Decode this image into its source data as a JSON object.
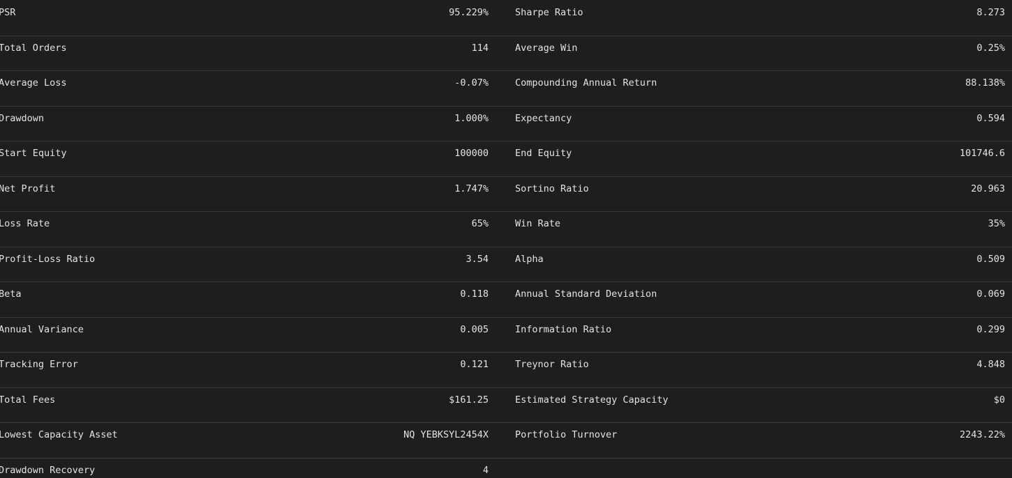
{
  "rows": [
    {
      "left": {
        "label": "PSR",
        "value": "95.229%"
      },
      "right": {
        "label": "Sharpe Ratio",
        "value": "8.273"
      }
    },
    {
      "left": {
        "label": "Total Orders",
        "value": "114"
      },
      "right": {
        "label": "Average Win",
        "value": "0.25%"
      }
    },
    {
      "left": {
        "label": "Average Loss",
        "value": "-0.07%"
      },
      "right": {
        "label": "Compounding Annual Return",
        "value": "88.138%"
      }
    },
    {
      "left": {
        "label": "Drawdown",
        "value": "1.000%"
      },
      "right": {
        "label": "Expectancy",
        "value": "0.594"
      }
    },
    {
      "left": {
        "label": "Start Equity",
        "value": "100000"
      },
      "right": {
        "label": "End Equity",
        "value": "101746.6"
      }
    },
    {
      "left": {
        "label": "Net Profit",
        "value": "1.747%"
      },
      "right": {
        "label": "Sortino Ratio",
        "value": "20.963"
      }
    },
    {
      "left": {
        "label": "Loss Rate",
        "value": "65%"
      },
      "right": {
        "label": "Win Rate",
        "value": "35%"
      }
    },
    {
      "left": {
        "label": "Profit-Loss Ratio",
        "value": "3.54"
      },
      "right": {
        "label": "Alpha",
        "value": "0.509"
      }
    },
    {
      "left": {
        "label": "Beta",
        "value": "0.118"
      },
      "right": {
        "label": "Annual Standard Deviation",
        "value": "0.069"
      }
    },
    {
      "left": {
        "label": "Annual Variance",
        "value": "0.005"
      },
      "right": {
        "label": "Information Ratio",
        "value": "0.299"
      }
    },
    {
      "left": {
        "label": "Tracking Error",
        "value": "0.121"
      },
      "right": {
        "label": "Treynor Ratio",
        "value": "4.848"
      }
    },
    {
      "left": {
        "label": "Total Fees",
        "value": "$161.25"
      },
      "right": {
        "label": "Estimated Strategy Capacity",
        "value": "$0"
      }
    },
    {
      "left": {
        "label": "Lowest Capacity Asset",
        "value": "NQ YEBKSYL2454X"
      },
      "right": {
        "label": "Portfolio Turnover",
        "value": "2243.22%"
      }
    },
    {
      "left": {
        "label": "Drawdown Recovery",
        "value": "4"
      },
      "right": {
        "label": "",
        "value": ""
      }
    }
  ]
}
